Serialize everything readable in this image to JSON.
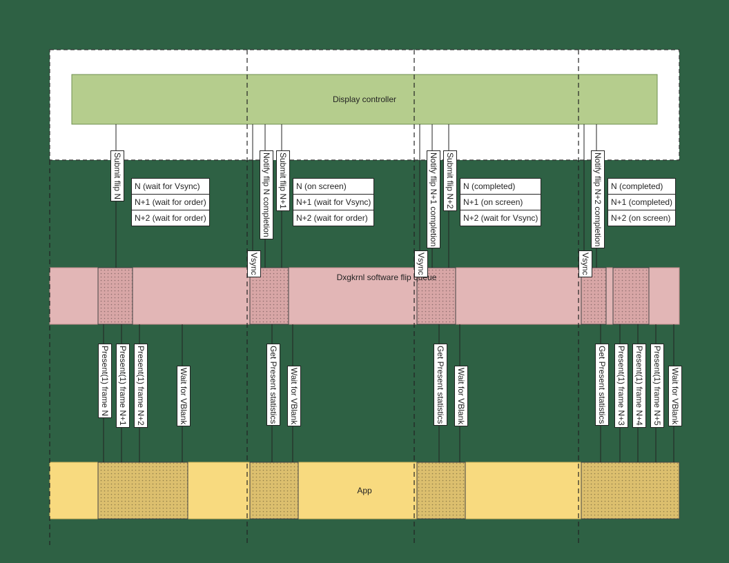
{
  "labels": {
    "display_controller": "Display controller",
    "dxgkrnl": "Dxgkrnl software flip queue",
    "app": "App",
    "vsync": "Vsync",
    "submit_flip_n": "Submit flip N",
    "submit_flip_n1": "Submit flip N+1",
    "submit_flip_n2": "Submit flip N+2",
    "notify_n": "Notify flip N completion",
    "notify_n1": "Notify flip N+1 completion",
    "notify_n2": "Notify flip N+2 completion",
    "present_n": "Present(1) frame N",
    "present_n1": "Present(1) frame N+1",
    "present_n2": "Present(1) frame N+2",
    "present_n3": "Present(1) frame N+3",
    "present_n4": "Present(1) frame N+4",
    "present_n5": "Present(1) frame N+5",
    "wait_vblank": "Wait for VBlank",
    "get_stats": "Get Present statistics"
  },
  "queues": {
    "q1": [
      "N (wait for Vsync)",
      "N+1 (wait for order)",
      "N+2 (wait for order)"
    ],
    "q2": [
      "N (on screen)",
      "N+1 (wait for Vsync)",
      "N+2 (wait for order)"
    ],
    "q3": [
      "N (completed)",
      "N+1 (on screen)",
      "N+2 (wait for Vsync)"
    ],
    "q4": [
      "N (completed)",
      "N+1 (completed)",
      "N+2 (on screen)"
    ]
  },
  "colors": {
    "display_fill": "#b5cd8d",
    "pink_fill": "#e2b6b6",
    "yellow_fill": "#f8da7f"
  }
}
